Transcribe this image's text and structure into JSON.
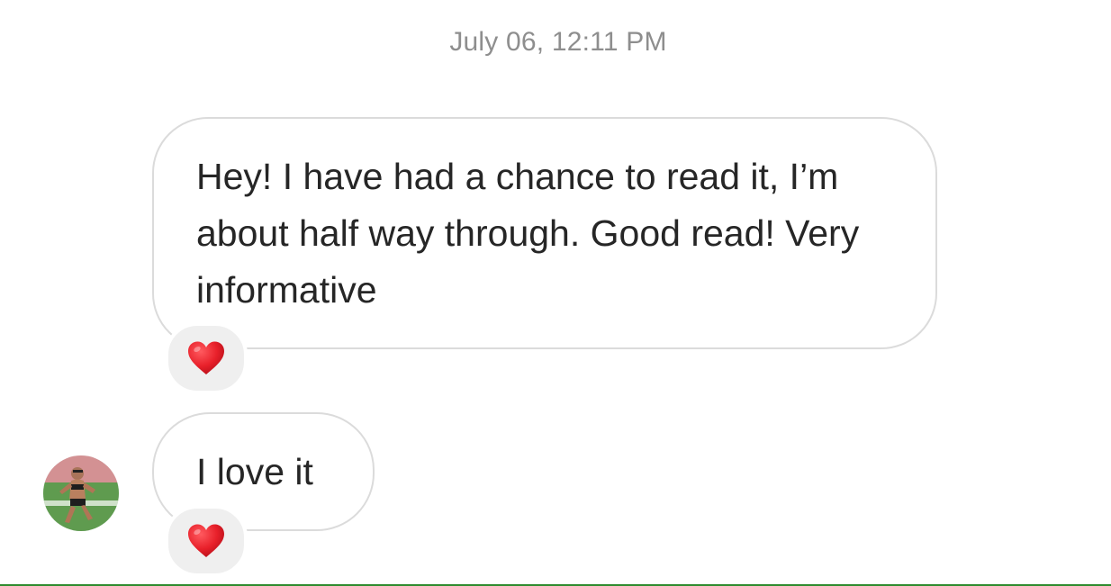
{
  "thread": {
    "timestamp": "July 06, 12:11 PM",
    "messages": [
      {
        "text": "Hey! I have had a chance to read it, I’m about half way through. Good read! Very informative",
        "reaction": "heart-emoji"
      },
      {
        "text": "I love it",
        "reaction": "heart-emoji"
      }
    ]
  },
  "colors": {
    "bubble_border": "#dbdbdb",
    "reaction_bg": "#efefef",
    "timestamp_text": "#8e8e8e",
    "message_text": "#262626",
    "heart": "#e8202a"
  }
}
